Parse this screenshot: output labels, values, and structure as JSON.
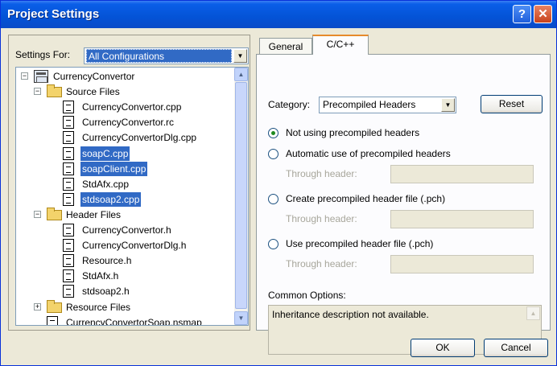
{
  "window": {
    "title": "Project Settings"
  },
  "titlebar_buttons": {
    "help": "?",
    "close": "✕"
  },
  "settings_for": {
    "label": "Settings For:",
    "value": "All Configurations"
  },
  "tree": {
    "items": [
      {
        "label": "CurrencyConvertor",
        "type": "project",
        "expanded": true,
        "selected": false
      },
      {
        "label": "Source Files",
        "type": "folder",
        "expanded": true,
        "selected": false
      },
      {
        "label": "CurrencyConvertor.cpp",
        "type": "file",
        "selected": false
      },
      {
        "label": "CurrencyConvertor.rc",
        "type": "file",
        "selected": false
      },
      {
        "label": "CurrencyConvertorDlg.cpp",
        "type": "file",
        "selected": false
      },
      {
        "label": "soapC.cpp",
        "type": "file",
        "selected": true
      },
      {
        "label": "soapClient.cpp",
        "type": "file",
        "selected": true
      },
      {
        "label": "StdAfx.cpp",
        "type": "file",
        "selected": false
      },
      {
        "label": "stdsoap2.cpp",
        "type": "file",
        "selected": true
      },
      {
        "label": "Header Files",
        "type": "folder",
        "expanded": true,
        "selected": false
      },
      {
        "label": "CurrencyConvertor.h",
        "type": "file",
        "selected": false
      },
      {
        "label": "CurrencyConvertorDlg.h",
        "type": "file",
        "selected": false
      },
      {
        "label": "Resource.h",
        "type": "file",
        "selected": false
      },
      {
        "label": "StdAfx.h",
        "type": "file",
        "selected": false
      },
      {
        "label": "stdsoap2.h",
        "type": "file",
        "selected": false
      },
      {
        "label": "Resource Files",
        "type": "folder",
        "expanded": false,
        "selected": false
      },
      {
        "label": "CurrencyConvertorSoap.nsmap",
        "type": "file",
        "selected": false
      }
    ]
  },
  "tabs": [
    {
      "label": "General",
      "active": false
    },
    {
      "label": "C/C++",
      "active": true
    }
  ],
  "category": {
    "label": "Category:",
    "value": "Precompiled Headers"
  },
  "reset_button": "Reset",
  "options": [
    {
      "label": "Not using precompiled headers",
      "checked": true
    },
    {
      "label": "Automatic use of precompiled headers",
      "checked": false,
      "through_header_label": "Through header:",
      "through_header_value": ""
    },
    {
      "label": "Create precompiled header file (.pch)",
      "checked": false,
      "through_header_label": "Through header:",
      "through_header_value": ""
    },
    {
      "label": "Use precompiled header file (.pch)",
      "checked": false,
      "through_header_label": "Through header:",
      "through_header_value": ""
    }
  ],
  "common_options": {
    "label": "Common Options:",
    "text": "Inheritance description not available."
  },
  "ok_button": "OK",
  "cancel_button": "Cancel",
  "colors": {
    "titlebar": "#0453d6",
    "selection": "#316ac5",
    "dialog_bg": "#ece9d8"
  }
}
